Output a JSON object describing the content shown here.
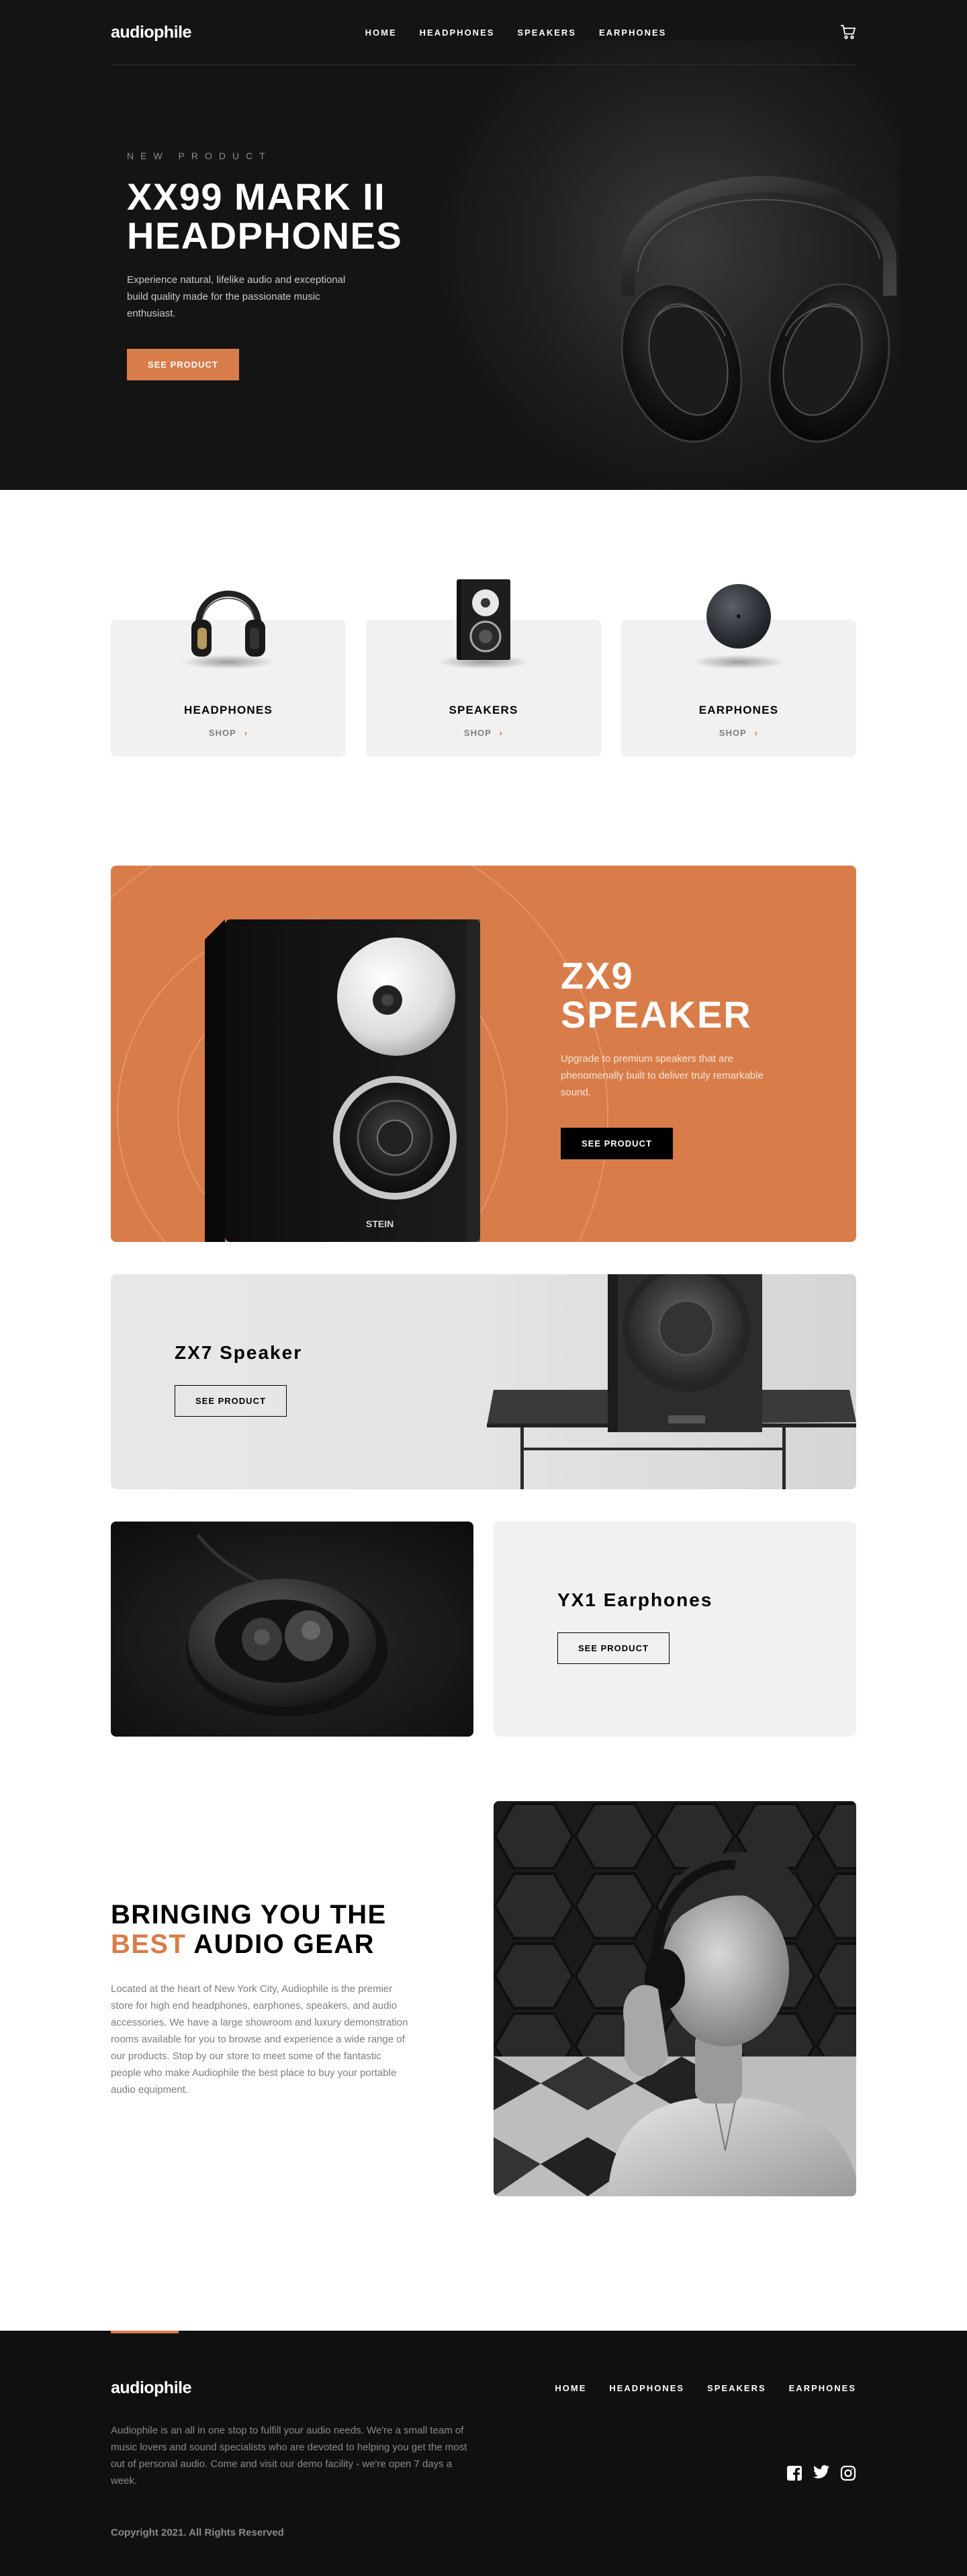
{
  "header": {
    "logo": "audiophile",
    "nav": [
      "HOME",
      "HEADPHONES",
      "SPEAKERS",
      "EARPHONES"
    ]
  },
  "hero": {
    "overline": "NEW PRODUCT",
    "title_line1": "XX99 MARK II",
    "title_line2": "HEADPHONES",
    "description": "Experience natural, lifelike audio and exceptional build quality made for the passionate music enthusiast.",
    "cta": "SEE PRODUCT"
  },
  "categories": [
    {
      "name": "HEADPHONES",
      "shop": "SHOP"
    },
    {
      "name": "SPEAKERS",
      "shop": "SHOP"
    },
    {
      "name": "EARPHONES",
      "shop": "SHOP"
    }
  ],
  "zx9": {
    "title_line1": "ZX9",
    "title_line2": "SPEAKER",
    "description": "Upgrade to premium speakers that are phenomenally built to deliver truly remarkable sound.",
    "cta": "SEE PRODUCT",
    "speaker_brand": "STEIN"
  },
  "zx7": {
    "title": "ZX7 Speaker",
    "cta": "SEE PRODUCT"
  },
  "yx1": {
    "title": "YX1 Earphones",
    "cta": "SEE PRODUCT"
  },
  "about": {
    "title_line1": "BRINGING YOU THE",
    "title_accent": "BEST",
    "title_rest": " AUDIO GEAR",
    "description": "Located at the heart of New York City, Audiophile is the premier store for high end headphones, earphones, speakers, and audio accessories. We have a large showroom and luxury demonstration rooms available for you to browse and experience a wide range of our products. Stop by our store to meet some of the fantastic people who make Audiophile the best place to buy your portable audio equipment."
  },
  "footer": {
    "logo": "audiophile",
    "nav": [
      "HOME",
      "HEADPHONES",
      "SPEAKERS",
      "EARPHONES"
    ],
    "description": "Audiophile is an all in one stop to fulfill your audio needs. We're a small team of music lovers and sound specialists who are devoted to helping you get the most out of personal audio. Come and visit our demo facility - we're open 7 days a week.",
    "copyright": "Copyright 2021. All Rights Reserved",
    "social": [
      "facebook-icon",
      "twitter-icon",
      "instagram-icon"
    ]
  },
  "colors": {
    "accent": "#d87d4a",
    "dark": "#141414",
    "light_gray": "#f1f1f1"
  }
}
